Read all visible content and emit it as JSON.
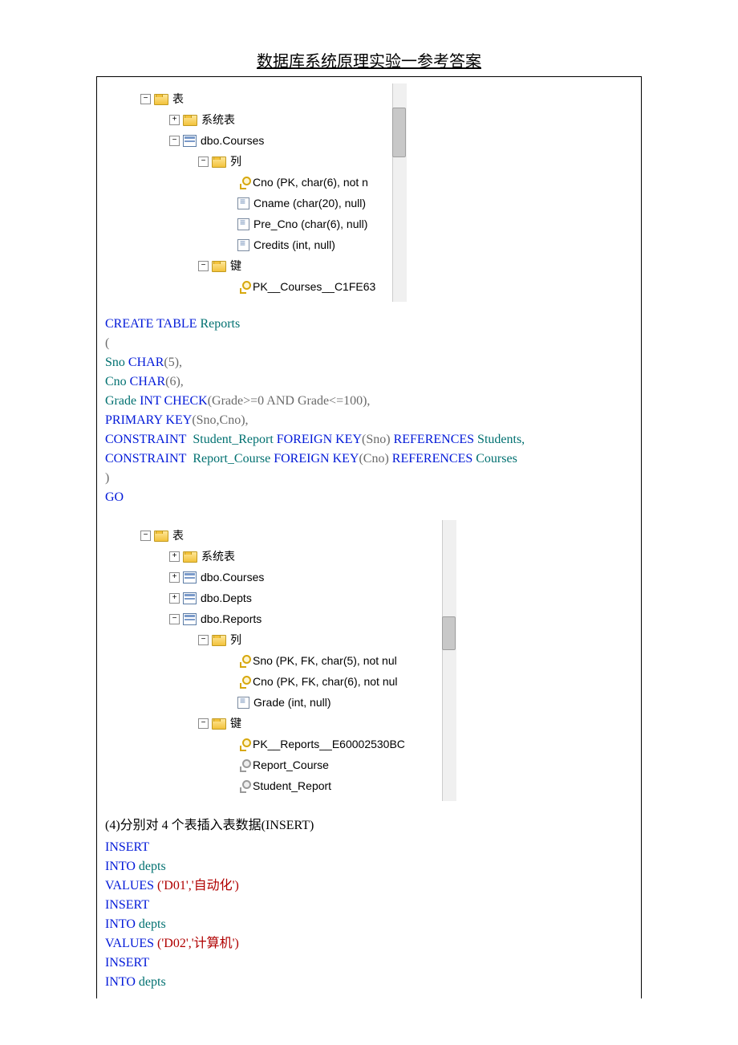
{
  "title": "数据库系统原理实验一参考答案",
  "tree1": {
    "n0": "表",
    "n1": "系统表",
    "n2": "dbo.Courses",
    "n3": "列",
    "c0": "Cno (PK, char(6), not n",
    "c1": "Cname (char(20), null)",
    "c2": "Pre_Cno (char(6), null)",
    "c3": "Credits (int, null)",
    "n4": "键",
    "k0": "PK__Courses__C1FE63"
  },
  "sql1": {
    "l1a": "CREATE",
    "l1b": "TABLE",
    "l1c": "Reports",
    "l2": "(",
    "l3a": "Sno",
    "l3b": "CHAR",
    "l3c": "(5),",
    "l4a": "Cno",
    "l4b": "CHAR",
    "l4c": "(6),",
    "l5a": "Grade",
    "l5b": "INT",
    "l5c": "CHECK",
    "l5d": "(Grade>=0",
    "l5e": "AND",
    "l5f": "Grade<=100),",
    "l6a": "PRIMARY",
    "l6b": "KEY",
    "l6c": "(Sno,Cno),",
    "l7a": "CONSTRAINT",
    "l7b": "Student_Report",
    "l7c": "FOREIGN",
    "l7d": "KEY",
    "l7e": "(Sno)",
    "l7f": "REFERENCES",
    "l7g": "Students,",
    "l8a": "CONSTRAINT",
    "l8b": "Report_Course",
    "l8c": "FOREIGN",
    "l8d": "KEY",
    "l8e": "(Cno)",
    "l8f": "REFERENCES",
    "l8g": "Courses",
    "l9": ")",
    "l10": "GO"
  },
  "tree2": {
    "n0": "表",
    "n1": "系统表",
    "n2": "dbo.Courses",
    "n3": "dbo.Depts",
    "n4": "dbo.Reports",
    "n5": "列",
    "c0": "Sno (PK, FK, char(5), not nul",
    "c1": "Cno (PK, FK, char(6), not nul",
    "c2": "Grade (int, null)",
    "n6": "键",
    "k0": "PK__Reports__E60002530BC",
    "k1": "Report_Course",
    "k2": "Student_Report"
  },
  "section4": "(4)分别对 4 个表插入表数据(INSERT)",
  "sql2": {
    "a1": "INSERT",
    "a2a": "INTO",
    "a2b": "depts",
    "a3a": "VALUES",
    "a3b": "('D01','自动化')",
    "b1": "INSERT",
    "b2a": "INTO",
    "b2b": "depts",
    "b3a": "VALUES",
    "b3b": "('D02','计算机')",
    "c1": "INSERT",
    "c2a": "INTO",
    "c2b": "depts"
  },
  "glyph": {
    "minus": "−",
    "plus": "+"
  }
}
